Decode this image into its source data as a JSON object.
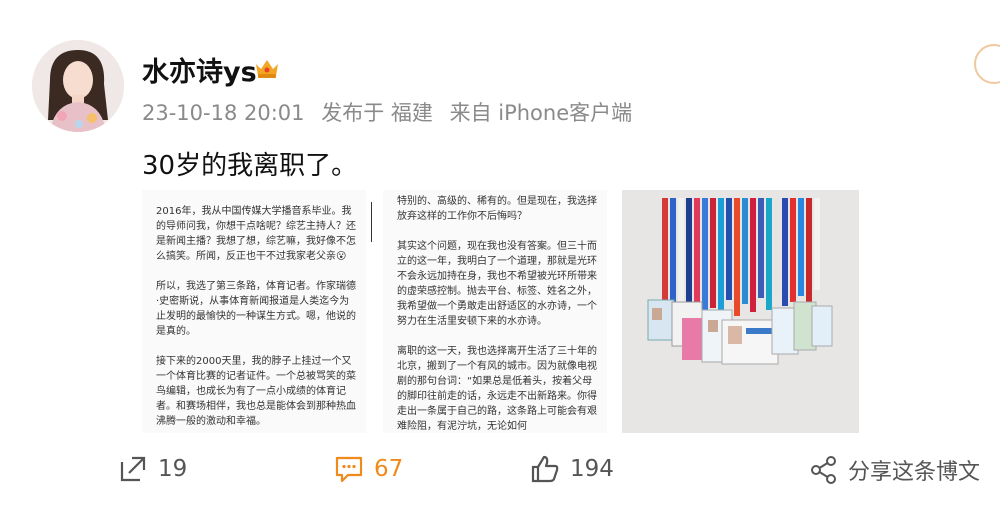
{
  "post": {
    "username": "水亦诗ys",
    "timestamp": "23-10-18 20:01",
    "location": "发布于 福建",
    "source": "来自 iPhone客户端",
    "text": "30岁的我离职了。"
  },
  "images": {
    "img1_text": "2016年，我从中国传媒大学播音系毕业。我的导师问我，你想干点啥呢？综艺主持人？还是新闻主播？我想了想，综艺嘛，我好像不怎么搞笑。所闻，反正也干不过我家老父亲😮\n\n所以，我选了第三条路，体育记者。作家瑞德·史密斯说，从事体育新闻报道是人类迄今为止发明的最愉快的一种谋生方式。嗯，他说的是真的。\n\n接下来的2000天里，我的脖子上挂过一个又一个体育比赛的记者证件。一个总被骂笑的菜鸟编辑，也成长为有了一点小成绩的体育记者。和赛场相伴，我也总是能体会到那种热血沸腾一般的激动和幸福。",
    "img2_text": "特别的、高级的、稀有的。但是现在，我选择放弃这样的工作你不后悔吗？\n\n其实这个问题，现在我也没有答案。但三十而立的这一年，我明白了一个道理，那就是光环不会永远加持在身，我也不希望被光环所带来的虚荣感控制。抛去平台、标签、姓名之外，我希望做一个勇敢走出舒适区的水亦诗，一个努力在生活里安顿下来的水亦诗。\n\n离职的这一天，我也选择离开生活了三十年的北京，搬到了一个有风的城市。因为就像电视剧的那句台词：“如果总是低着头，按着父母的脚印往前走的话，永远走不出新路来。你得走出一条属于自己的路，这条路上可能会有艰难险阻，有泥泞坑，无论如何"
  },
  "actions": {
    "repost_count": "19",
    "comment_count": "67",
    "like_count": "194",
    "share_label": "分享这条博文"
  },
  "icons": {
    "repost": "repost-icon",
    "comment": "comment-icon",
    "like": "thumbs-up-icon",
    "share": "share-icon",
    "vip": "crown-icon"
  }
}
